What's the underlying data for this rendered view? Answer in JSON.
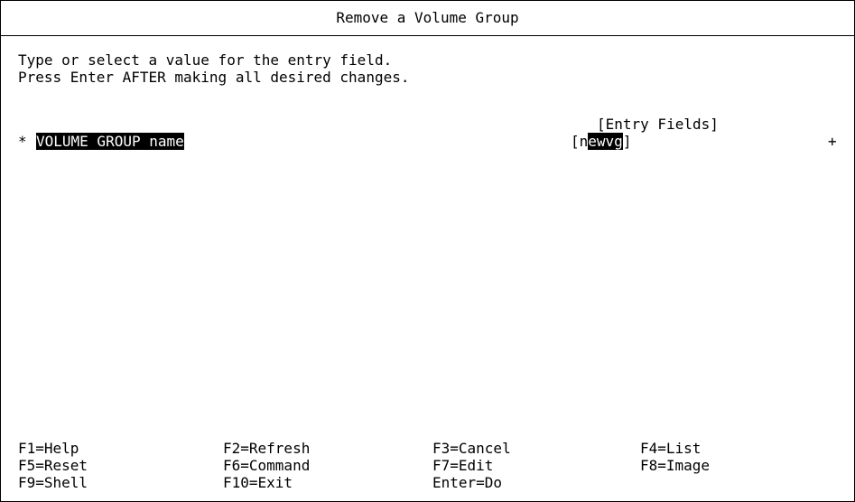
{
  "screen": {
    "title": "Remove a Volume Group",
    "instructions": [
      "Type or select a value for the entry field.",
      "Press Enter AFTER making all desired changes."
    ],
    "entry_fields_header": "[Entry Fields]",
    "field": {
      "required_marker": "*",
      "label": "VOLUME GROUP name",
      "bracket_open": "[",
      "value_head": "n",
      "value_highlight": "ewvg",
      "bracket_close": "]",
      "list_indicator": "+"
    }
  },
  "function_keys": {
    "rows": [
      [
        "F1=Help",
        "F2=Refresh",
        "F3=Cancel",
        "F4=List"
      ],
      [
        "F5=Reset",
        "F6=Command",
        "F7=Edit",
        "F8=Image"
      ],
      [
        "F9=Shell",
        "F10=Exit",
        "Enter=Do",
        ""
      ]
    ]
  },
  "colors": {
    "foreground": "#000000",
    "background": "#ffffff",
    "highlight_background": "#000000",
    "highlight_foreground": "#ffffff"
  }
}
